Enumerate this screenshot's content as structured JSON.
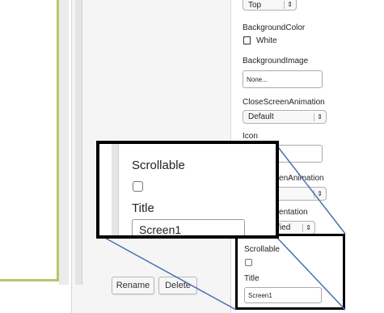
{
  "components": {
    "rename_label": "Rename",
    "delete_label": "Delete"
  },
  "properties": {
    "align_vertical_value": "Top",
    "background_color_label": "BackgroundColor",
    "background_color_value": "White",
    "background_image_label": "BackgroundImage",
    "background_image_value": "None...",
    "close_screen_animation_label": "CloseScreenAnimation",
    "close_screen_animation_value": "Default",
    "icon_label": "Icon",
    "open_screen_animation_label": "OpenScreenAnimation",
    "screen_orientation_label": "ScreenOrientation",
    "screen_orientation_value": "Unspecified",
    "scrollable_label": "Scrollable",
    "title_label": "Title",
    "title_value": "Screen1"
  },
  "zoom": {
    "scrollable_label": "Scrollable",
    "title_label": "Title",
    "title_value": "Screen1"
  },
  "colors": {
    "viewer_border": "#b5c76a",
    "callout_line": "#4a6fb0"
  }
}
